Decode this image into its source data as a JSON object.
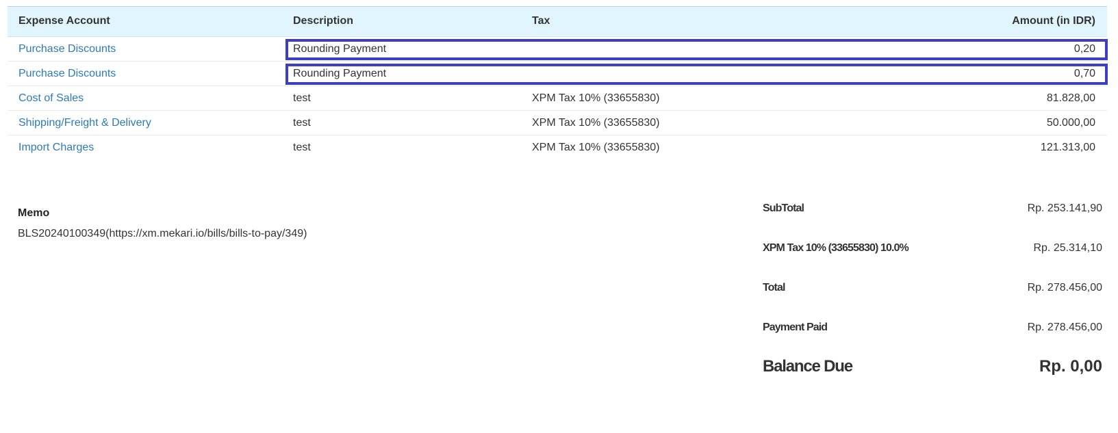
{
  "table": {
    "headers": {
      "account": "Expense Account",
      "description": "Description",
      "tax": "Tax",
      "amount": "Amount (in IDR)"
    },
    "rows": [
      {
        "account": "Purchase Discounts",
        "description": "Rounding Payment",
        "tax": "",
        "amount": "0,20",
        "highlighted": true
      },
      {
        "account": "Purchase Discounts",
        "description": "Rounding Payment",
        "tax": "",
        "amount": "0,70",
        "highlighted": true
      },
      {
        "account": "Cost of Sales",
        "description": "test",
        "tax": "XPM Tax 10% (33655830)",
        "amount": "81.828,00",
        "highlighted": false
      },
      {
        "account": "Shipping/Freight & Delivery",
        "description": "test",
        "tax": "XPM Tax 10% (33655830)",
        "amount": "50.000,00",
        "highlighted": false
      },
      {
        "account": "Import Charges",
        "description": "test",
        "tax": "XPM Tax 10% (33655830)",
        "amount": "121.313,00",
        "highlighted": false
      }
    ]
  },
  "memo": {
    "title": "Memo",
    "text": "BLS20240100349(https://xm.mekari.io/bills/bills-to-pay/349)"
  },
  "totals": {
    "subtotal_label": "SubTotal",
    "subtotal_value": "Rp. 253.141,90",
    "tax_label": "XPM Tax 10% (33655830) 10.0%",
    "tax_value": "Rp. 25.314,10",
    "total_label": "Total",
    "total_value": "Rp. 278.456,00",
    "paid_label": "Payment Paid",
    "paid_value": "Rp. 278.456,00",
    "balance_label": "Balance Due",
    "balance_value": "Rp. 0,00"
  },
  "colors": {
    "header_bg": "#e1f5fe",
    "link": "#2d7ab8",
    "highlight_border": "#3a3fc4"
  }
}
